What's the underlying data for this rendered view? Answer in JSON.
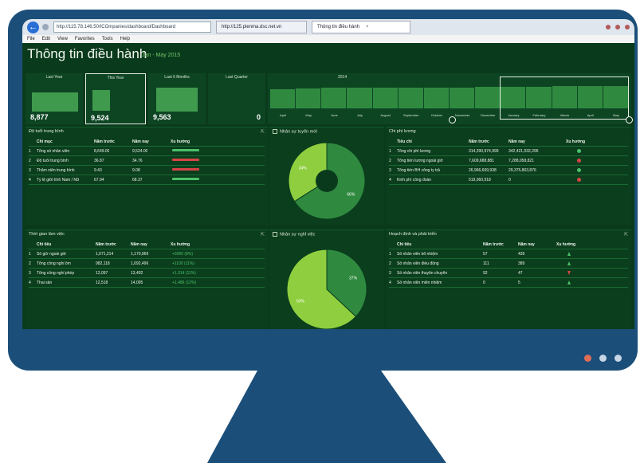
{
  "colors": {
    "monitor": "#1b4f79",
    "screen": "#0a3a1c",
    "accent": "#3f9a4e",
    "up": "#4bc06a",
    "down": "#d64545",
    "dot_active": "#e06c57",
    "dot": "#c8d6e6"
  },
  "browser": {
    "url": "http://115.78.146.50/ICOmpanies/dashboard/Dashboard",
    "tabs": [
      {
        "label": "http://125.plenma.dsc.net.vn"
      },
      {
        "label": "Thông tin điều hành"
      }
    ],
    "menu": [
      "File",
      "Edit",
      "View",
      "Favorites",
      "Tools",
      "Help"
    ]
  },
  "dashboard": {
    "title": "Thông tin điều hành",
    "subtitle": "Jan - May 2015"
  },
  "kpis": [
    {
      "label": "Last Year",
      "value": "8,877",
      "fill": 0.6
    },
    {
      "label": "This Year",
      "value": "9,524",
      "fill": 0.64
    },
    {
      "label": "Last 6 Months",
      "value": "9,563",
      "fill": 0.75
    },
    {
      "label": "Last Quarter",
      "value": "0",
      "fill": 0
    }
  ],
  "timeline": {
    "year": "2014",
    "months": [
      "April",
      "May",
      "June",
      "July",
      "August",
      "September",
      "October",
      "November",
      "December",
      "January",
      "February",
      "March",
      "April",
      "May"
    ],
    "levels": [
      0.72,
      0.74,
      0.75,
      0.76,
      0.76,
      0.77,
      0.77,
      0.76,
      0.78,
      0.8,
      0.8,
      0.81,
      0.81,
      0.82
    ]
  },
  "panels": {
    "age": {
      "title": "Độ tuổi trung bình",
      "headers": [
        "Chỉ mục",
        "Năm trước",
        "Năm nay",
        "Xu hướng"
      ],
      "rows": [
        {
          "idx": "1",
          "name": "Tổng số nhân viên",
          "prev": "8,649.00",
          "cur": "9,524.00",
          "trend": "up"
        },
        {
          "idx": "2",
          "name": "Độ tuổi trung bình",
          "prev": "36.87",
          "cur": "34.76",
          "trend": "down"
        },
        {
          "idx": "3",
          "name": "Thâm niên trung bình",
          "prev": "9.43",
          "cur": "9.08",
          "trend": "down"
        },
        {
          "idx": "4",
          "name": "Tỷ lệ giới tính Nam / Nữ",
          "prev": "67.94",
          "cur": "68.37",
          "trend": "up"
        }
      ]
    },
    "newhires": {
      "title": "Nhân sự tuyển mới",
      "chart_data": {
        "type": "pie",
        "values": [
          66,
          34
        ],
        "labels": [
          "66%",
          "34%"
        ]
      }
    },
    "salary": {
      "title": "Chi phí lương",
      "headers": [
        "Tiêu chí",
        "Năm trước",
        "Năm nay",
        "Xu hướng"
      ],
      "rows": [
        {
          "idx": "1",
          "name": "Tổng chi phí lương",
          "prev": "314,290,974,999",
          "cur": "342,421,032,296",
          "trend": "up"
        },
        {
          "idx": "2",
          "name": "Tổng tiền lương ngoài giờ",
          "prev": "7,609,688,881",
          "cur": "7,288,058,821",
          "trend": "down"
        },
        {
          "idx": "3",
          "name": "Tổng tiền BH công ty trả",
          "prev": "26,966,669,938",
          "cur": "29,375,863,876",
          "trend": "up"
        },
        {
          "idx": "4",
          "name": "Kinh phí công đoàn",
          "prev": "519,060,918",
          "cur": "0",
          "trend": "down"
        }
      ]
    },
    "worktime": {
      "title": "Thời gian làm việc",
      "headers": [
        "Chỉ tiêu",
        "Năm trước",
        "Năm nay",
        "Xu hướng"
      ],
      "rows": [
        {
          "idx": "1",
          "name": "Số giờ ngoài giờ",
          "prev": "1,071,214",
          "cur": "1,170,969",
          "trend": "+3000 (8%)"
        },
        {
          "idx": "2",
          "name": "Tổng công nghỉ ốm",
          "prev": "982,118",
          "cur": "1,092,496",
          "trend": "+1100 (11%)"
        },
        {
          "idx": "3",
          "name": "Tổng công nghỉ phép",
          "prev": "12,097",
          "cur": "13,402",
          "trend": "+1,314 (11%)"
        },
        {
          "idx": "4",
          "name": "Thai sản",
          "prev": "12,518",
          "cur": "14,095",
          "trend": "+1,486 (12%)"
        }
      ]
    },
    "leavers": {
      "title": "Nhân sự nghỉ việc",
      "chart_data": {
        "type": "pie",
        "values": [
          37,
          63
        ],
        "labels": [
          "37%",
          "63%"
        ]
      }
    },
    "planning": {
      "title": "Hoạch định và phát triển",
      "headers": [
        "Chỉ tiêu",
        "Năm trước",
        "Năm nay",
        "Xu hướng"
      ],
      "rows": [
        {
          "idx": "1",
          "name": "Số nhân viên bổ nhiệm",
          "prev": "57",
          "cur": "439",
          "trend": "up"
        },
        {
          "idx": "2",
          "name": "Số nhân viên điều động",
          "prev": "111",
          "cur": "389",
          "trend": "up"
        },
        {
          "idx": "3",
          "name": "Số nhân viên thuyên chuyển",
          "prev": "92",
          "cur": "47",
          "trend": "down"
        },
        {
          "idx": "4",
          "name": "Số nhân viên miễn nhiệm",
          "prev": "0",
          "cur": "5",
          "trend": "up"
        }
      ]
    }
  }
}
